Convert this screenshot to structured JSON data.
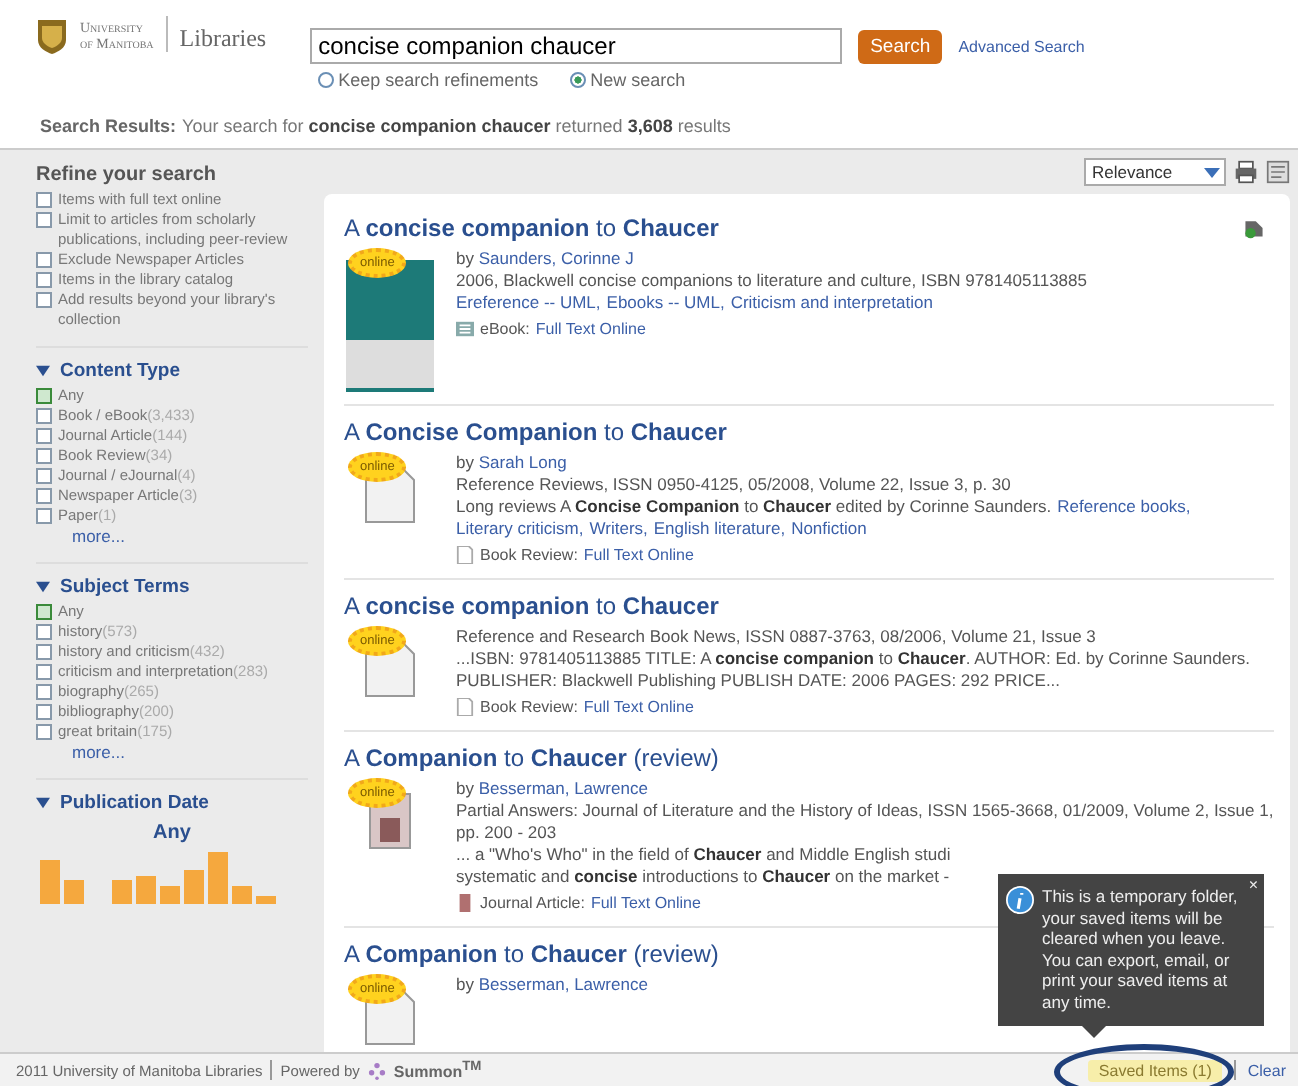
{
  "header": {
    "logo": {
      "line1": "University",
      "line2": "of Manitoba",
      "name": "Libraries"
    },
    "search": {
      "value": "concise companion chaucer",
      "button": "Search",
      "advanced": "Advanced Search",
      "options": [
        {
          "label": "Keep search refinements",
          "selected": false
        },
        {
          "label": "New search",
          "selected": true
        }
      ]
    }
  },
  "summary": {
    "label": "Search Results:",
    "text": "Your search for **concise companion chaucer** returned **3,608** results"
  },
  "sidebar": {
    "title": "Refine your search",
    "filters": [
      {
        "label": "Items with full text online",
        "checked": false
      },
      {
        "label": "Limit to articles from scholarly publications, including peer-review",
        "checked": false
      },
      {
        "label": "Exclude Newspaper Articles",
        "checked": false
      },
      {
        "label": "Items in the library catalog",
        "checked": false
      },
      {
        "label": "Add results beyond your library's collection",
        "checked": false
      }
    ],
    "facets": [
      {
        "kind": "list",
        "title": "Content Type",
        "expanded": true,
        "more": "more...",
        "items": [
          {
            "label": "Any",
            "checked": true
          },
          {
            "label": "Book / eBook",
            "count": "(3,433)",
            "checked": false
          },
          {
            "label": "Journal Article",
            "count": "(144)",
            "checked": false
          },
          {
            "label": "Book Review",
            "count": "(34)",
            "checked": false
          },
          {
            "label": "Journal / eJournal",
            "count": "(4)",
            "checked": false
          },
          {
            "label": "Newspaper Article",
            "count": "(3)",
            "checked": false
          },
          {
            "label": "Paper",
            "count": "(1)",
            "checked": false
          }
        ]
      },
      {
        "kind": "list",
        "title": "Subject Terms",
        "expanded": true,
        "more": "more...",
        "items": [
          {
            "label": "Any",
            "checked": true
          },
          {
            "label": "history",
            "count": "(573)",
            "checked": false
          },
          {
            "label": "history and criticism",
            "count": "(432)",
            "checked": false
          },
          {
            "label": "criticism and interpretation",
            "count": "(283)",
            "checked": false
          },
          {
            "label": "biography",
            "count": "(265)",
            "checked": false
          },
          {
            "label": "bibliography",
            "count": "(200)",
            "checked": false
          },
          {
            "label": "great britain",
            "count": "(175)",
            "checked": false
          }
        ]
      },
      {
        "kind": "histogram",
        "title": "Publication Date",
        "expanded": true,
        "value": "Any"
      }
    ]
  },
  "toolbar": {
    "sort": "Relevance"
  },
  "results": [
    {
      "title": "A **concise companion** to **Chaucer**",
      "kind": "cover",
      "badge": "online",
      "saved": true,
      "author": {
        "prefix": "by",
        "name": "Saunders, Corinne J"
      },
      "lines": [
        "2006, Blackwell concise companions to literature and culture, ISBN 9781405113885"
      ],
      "subjects": [
        "Ereference -- UML,",
        "Ebooks -- UML,",
        "Criticism and interpretation"
      ],
      "format": {
        "kind": "ebook",
        "label": "eBook:",
        "link": "Full Text Online"
      }
    },
    {
      "title": "A **Concise Companion** to **Chaucer**",
      "kind": "doc",
      "badge": "online",
      "saved": false,
      "author": {
        "prefix": "by",
        "name": "Sarah Long"
      },
      "lines": [
        "Reference Reviews, ISSN 0950-4125, 05/2008, Volume 22, Issue 3, p. 30"
      ],
      "snippet": [
        "Long reviews A **Concise Companion** to **Chaucer** edited by Corinne Saunders."
      ],
      "subjects": [
        "Reference books,",
        "Literary criticism,",
        "Writers,",
        "English literature,",
        "Nonfiction"
      ],
      "format": {
        "kind": "review",
        "label": "Book Review:",
        "link": "Full Text Online"
      }
    },
    {
      "title": "A **concise companion** to **Chaucer**",
      "kind": "doc",
      "badge": "online",
      "saved": false,
      "lines": [
        "Reference and Research Book News, ISSN 0887-3763, 08/2006, Volume 21, Issue 3"
      ],
      "snippet": [
        "...ISBN: 9781405113885 TITLE: A **concise companion** to **Chaucer**. AUTHOR: Ed. by Corinne Saunders. PUBLISHER: Blackwell Publishing PUBLISH DATE: 2006 PAGES: 292 PRICE..."
      ],
      "format": {
        "kind": "review",
        "label": "Book Review:",
        "link": "Full Text Online"
      }
    },
    {
      "title": "A **Companion** to **Chaucer** (review)",
      "kind": "article",
      "badge": "online",
      "saved": false,
      "author": {
        "prefix": "by",
        "name": "Besserman, Lawrence"
      },
      "lines": [
        "Partial Answers: Journal of Literature and the History of Ideas, ISSN 1565-3668, 01/2009, Volume 2, Issue 1, pp. 200 - 203"
      ],
      "snippet": [
        "... a \"Who's Who\" in the field of **Chaucer** and Middle English studi",
        "systematic and **concise** introductions to **Chaucer** on the market -"
      ],
      "format": {
        "kind": "article",
        "label": "Journal Article:",
        "link": "Full Text Online"
      }
    },
    {
      "title": "A **Companion** to **Chaucer** (review)",
      "kind": "doc",
      "badge": "online",
      "saved": false,
      "author": {
        "prefix": "by",
        "name": "Besserman, Lawrence"
      }
    }
  ],
  "tooltip": {
    "text": "This is a temporary folder, your saved items will be cleared when you leave. You can export, email, or print your saved items at any time.",
    "close": "×"
  },
  "footer": {
    "copyright": "2011 University of Manitoba Libraries",
    "powered": "Powered by",
    "brand": "Summon$^{TM}$",
    "saved": "Saved Items (1)",
    "clear": "Clear"
  }
}
